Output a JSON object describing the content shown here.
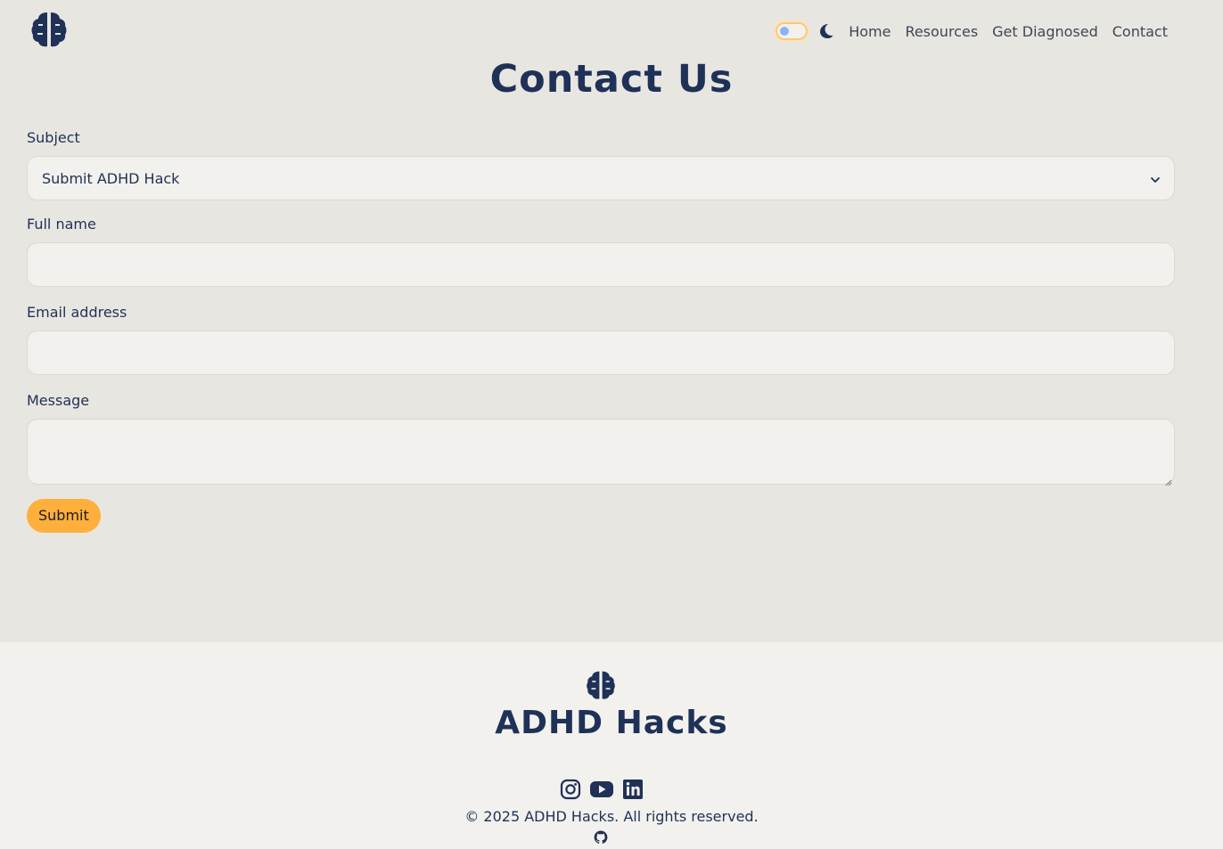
{
  "colors": {
    "background": "#e8e6e1",
    "surface": "#f2f1ed",
    "primary_text": "#1f3157",
    "accent": "#ffaf3b"
  },
  "header": {
    "logo_icon": "brain-icon",
    "theme_toggle_icon": "toggle-switch",
    "dark_mode_icon": "moon-icon",
    "nav": [
      {
        "label": "Home"
      },
      {
        "label": "Resources"
      },
      {
        "label": "Get Diagnosed"
      },
      {
        "label": "Contact"
      }
    ]
  },
  "page": {
    "title": "Contact Us"
  },
  "form": {
    "subject": {
      "label": "Subject",
      "value": "Submit ADHD Hack",
      "icon": "chevron-down-icon"
    },
    "full_name": {
      "label": "Full name",
      "value": ""
    },
    "email": {
      "label": "Email address",
      "value": ""
    },
    "message": {
      "label": "Message",
      "value": ""
    },
    "submit_label": "Submit"
  },
  "footer": {
    "logo_icon": "brain-icon",
    "brand": "ADHD Hacks",
    "social_icons": [
      "instagram-icon",
      "youtube-icon",
      "linkedin-icon"
    ],
    "copyright": "© 2025 ADHD Hacks. All rights reserved.",
    "github_icon": "github-icon"
  }
}
